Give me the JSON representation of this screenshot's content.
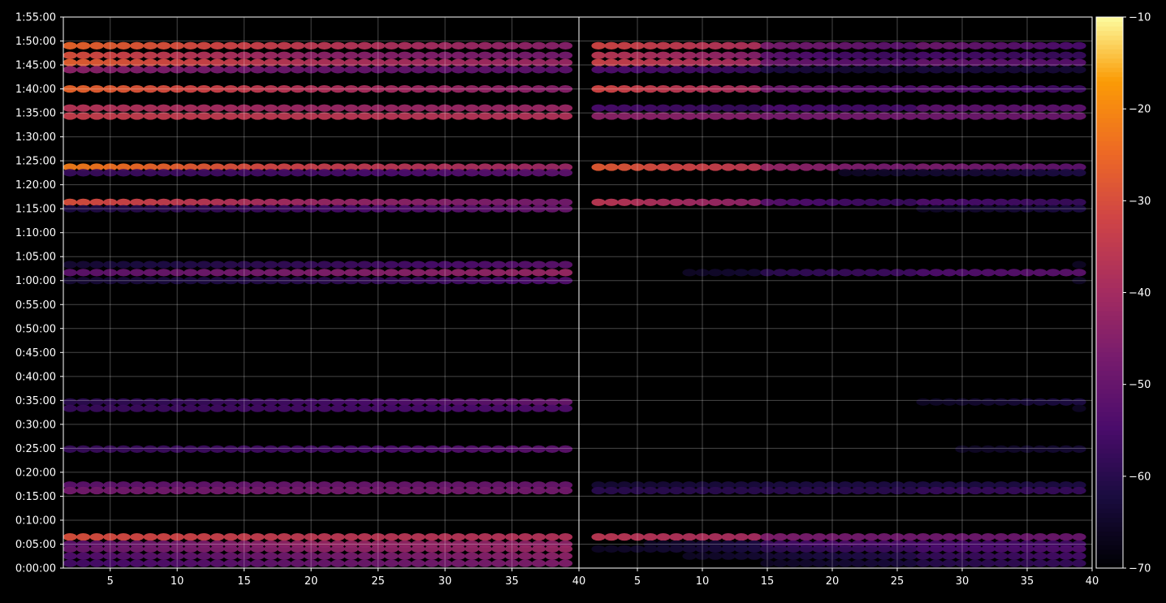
{
  "chart_data": {
    "type": "heatmap",
    "title": "",
    "xlabel": "",
    "ylabel": "",
    "grid": true,
    "colormap": "inferno",
    "background": "#000000",
    "grid_color": "#ffffff",
    "panels": [
      {
        "name": "",
        "xlim": [
          1.5,
          40
        ],
        "x_ticks": [
          5,
          10,
          15,
          20,
          25,
          30,
          35,
          40
        ],
        "x_tick_labels": [
          "5",
          "10",
          "15",
          "20",
          "25",
          "30",
          "35",
          "40"
        ]
      },
      {
        "name": "",
        "xlim": [
          0.5,
          40
        ],
        "x_ticks": [
          5,
          10,
          15,
          20,
          25,
          30,
          35,
          40
        ],
        "x_tick_labels": [
          "5",
          "10",
          "15",
          "20",
          "25",
          "30",
          "35",
          "40"
        ]
      }
    ],
    "y_axis": {
      "unit": "seconds",
      "ylim": [
        0,
        6900
      ],
      "tick_values": [
        0,
        300,
        600,
        900,
        1200,
        1500,
        1800,
        2100,
        2400,
        2700,
        3000,
        3300,
        3600,
        3900,
        4200,
        4500,
        4800,
        5100,
        5400,
        5700,
        6000,
        6300,
        6600,
        6900
      ],
      "tick_labels": [
        "0:00:00",
        "0:05:00",
        "0:10:00",
        "0:15:00",
        "0:20:00",
        "0:25:00",
        "0:30:00",
        "0:35:00",
        "0:40:00",
        "0:45:00",
        "0:50:00",
        "0:55:00",
        "1:00:00",
        "1:05:00",
        "1:10:00",
        "1:15:00",
        "1:20:00",
        "1:25:00",
        "1:30:00",
        "1:35:00",
        "1:40:00",
        "1:45:00",
        "1:50:00",
        "1:55:00"
      ]
    },
    "colorbar": {
      "vmin": -70,
      "vmax": -10,
      "ticks": [
        -10,
        -20,
        -30,
        -40,
        -50,
        -60,
        -70
      ],
      "tick_labels": [
        "−10",
        "−20",
        "−30",
        "−40",
        "−50",
        "−60",
        "−70"
      ]
    },
    "bands": [
      {
        "t": 6540,
        "lvl": [
          -26,
          -36,
          -45
        ],
        "gain": [
          0,
          -8,
          -4
        ]
      },
      {
        "t": 6420,
        "lvl": [
          -30,
          -44,
          -48
        ],
        "gain": [
          0,
          -6,
          -4
        ]
      },
      {
        "t": 6330,
        "lvl": [
          -27,
          -38,
          -42
        ],
        "gain": [
          0,
          -8,
          -5
        ]
      },
      {
        "t": 6240,
        "lvl": [
          -44,
          -50,
          -52
        ],
        "gain": [
          -4,
          -8,
          -6
        ]
      },
      {
        "t": 6000,
        "lvl": [
          -26,
          -38,
          -45
        ],
        "gain": [
          0,
          -8,
          -6
        ]
      },
      {
        "t": 5760,
        "lvl": [
          -37,
          -42,
          -42
        ],
        "gain": [
          -12,
          -8,
          -4
        ]
      },
      {
        "t": 5660,
        "lvl": [
          -34,
          -36,
          -38
        ],
        "gain": [
          -4,
          -6,
          -6
        ]
      },
      {
        "t": 5020,
        "lvl": [
          -22,
          -34,
          -42
        ],
        "gain": [
          0,
          -6,
          -4
        ]
      },
      {
        "t": 4950,
        "lvl": [
          -58,
          -56,
          -52
        ],
        "gain": [
          -4,
          -4,
          -4
        ]
      },
      {
        "t": 4580,
        "lvl": [
          -30,
          -42,
          -48
        ],
        "gain": [
          0,
          -8,
          -4
        ]
      },
      {
        "t": 4500,
        "lvl": [
          -62,
          -56,
          -50
        ],
        "gain": [
          -6,
          -6,
          -6
        ]
      },
      {
        "t": 3800,
        "lvl": [
          -64,
          -58,
          -52
        ],
        "gain": [
          -8,
          -8,
          -8
        ]
      },
      {
        "t": 3700,
        "lvl": [
          -52,
          -46,
          -42
        ],
        "gain": [
          -10,
          -6,
          -4
        ]
      },
      {
        "t": 3600,
        "lvl": [
          -64,
          -60,
          -54
        ],
        "gain": [
          -8,
          -8,
          -6
        ]
      },
      {
        "t": 2080,
        "lvl": [
          -60,
          -56,
          -50
        ],
        "gain": [
          -6,
          -6,
          -6
        ]
      },
      {
        "t": 2000,
        "lvl": [
          -58,
          -56,
          -54
        ],
        "gain": [
          -6,
          -6,
          -6
        ]
      },
      {
        "t": 1490,
        "lvl": [
          -58,
          -56,
          -52
        ],
        "gain": [
          -6,
          -6,
          -6
        ]
      },
      {
        "t": 1040,
        "lvl": [
          -52,
          -50,
          -50
        ],
        "gain": [
          -6,
          -6,
          -6
        ]
      },
      {
        "t": 970,
        "lvl": [
          -48,
          -48,
          -48
        ],
        "gain": [
          -6,
          -6,
          -4
        ]
      },
      {
        "t": 390,
        "lvl": [
          -30,
          -36,
          -38
        ],
        "gain": [
          0,
          -6,
          -6
        ]
      },
      {
        "t": 300,
        "lvl": [
          -52,
          -42,
          -44
        ],
        "gain": [
          -10,
          -6,
          -6
        ]
      },
      {
        "t": 240,
        "lvl": [
          -50,
          -44,
          -42
        ],
        "gain": [
          -10,
          -8,
          -6
        ]
      },
      {
        "t": 150,
        "lvl": [
          -54,
          -48,
          -44
        ],
        "gain": [
          -8,
          -8,
          -6
        ]
      },
      {
        "t": 60,
        "lvl": [
          -56,
          -50,
          -46
        ],
        "gain": [
          -8,
          -8,
          -6
        ]
      }
    ]
  }
}
